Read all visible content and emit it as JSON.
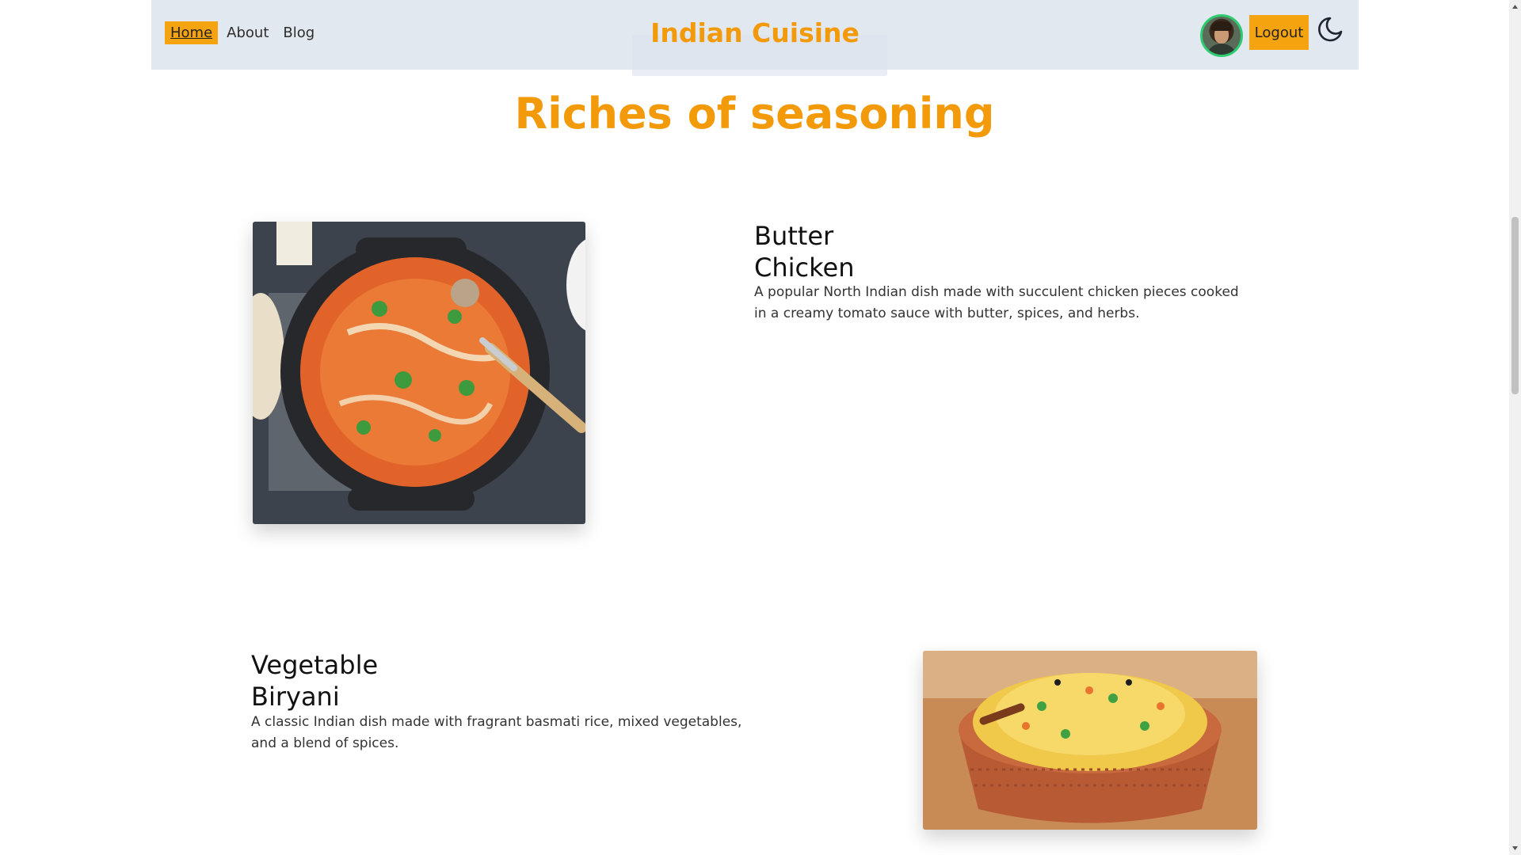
{
  "nav": {
    "links": [
      "Home",
      "About",
      "Blog"
    ],
    "brand": "Indian Cuisine",
    "logout_label": "Logout"
  },
  "page_title": "Riches of seasoning",
  "dishes": [
    {
      "name_line1": "Butter",
      "name_line2": "Chicken",
      "description": "A popular North Indian dish made with succulent chicken pieces cooked in a creamy tomato sauce with butter, spices, and herbs."
    },
    {
      "name_line1": "Vegetable",
      "name_line2": "Biryani",
      "description": "A classic Indian dish made with fragrant basmati rice, mixed vegetables, and a blend of spices."
    }
  ],
  "colors": {
    "accent": "#f5a30f",
    "brand": "#f29a0a",
    "navbar": "#e2e8f0",
    "avatar_ring": "#2ecc71"
  }
}
